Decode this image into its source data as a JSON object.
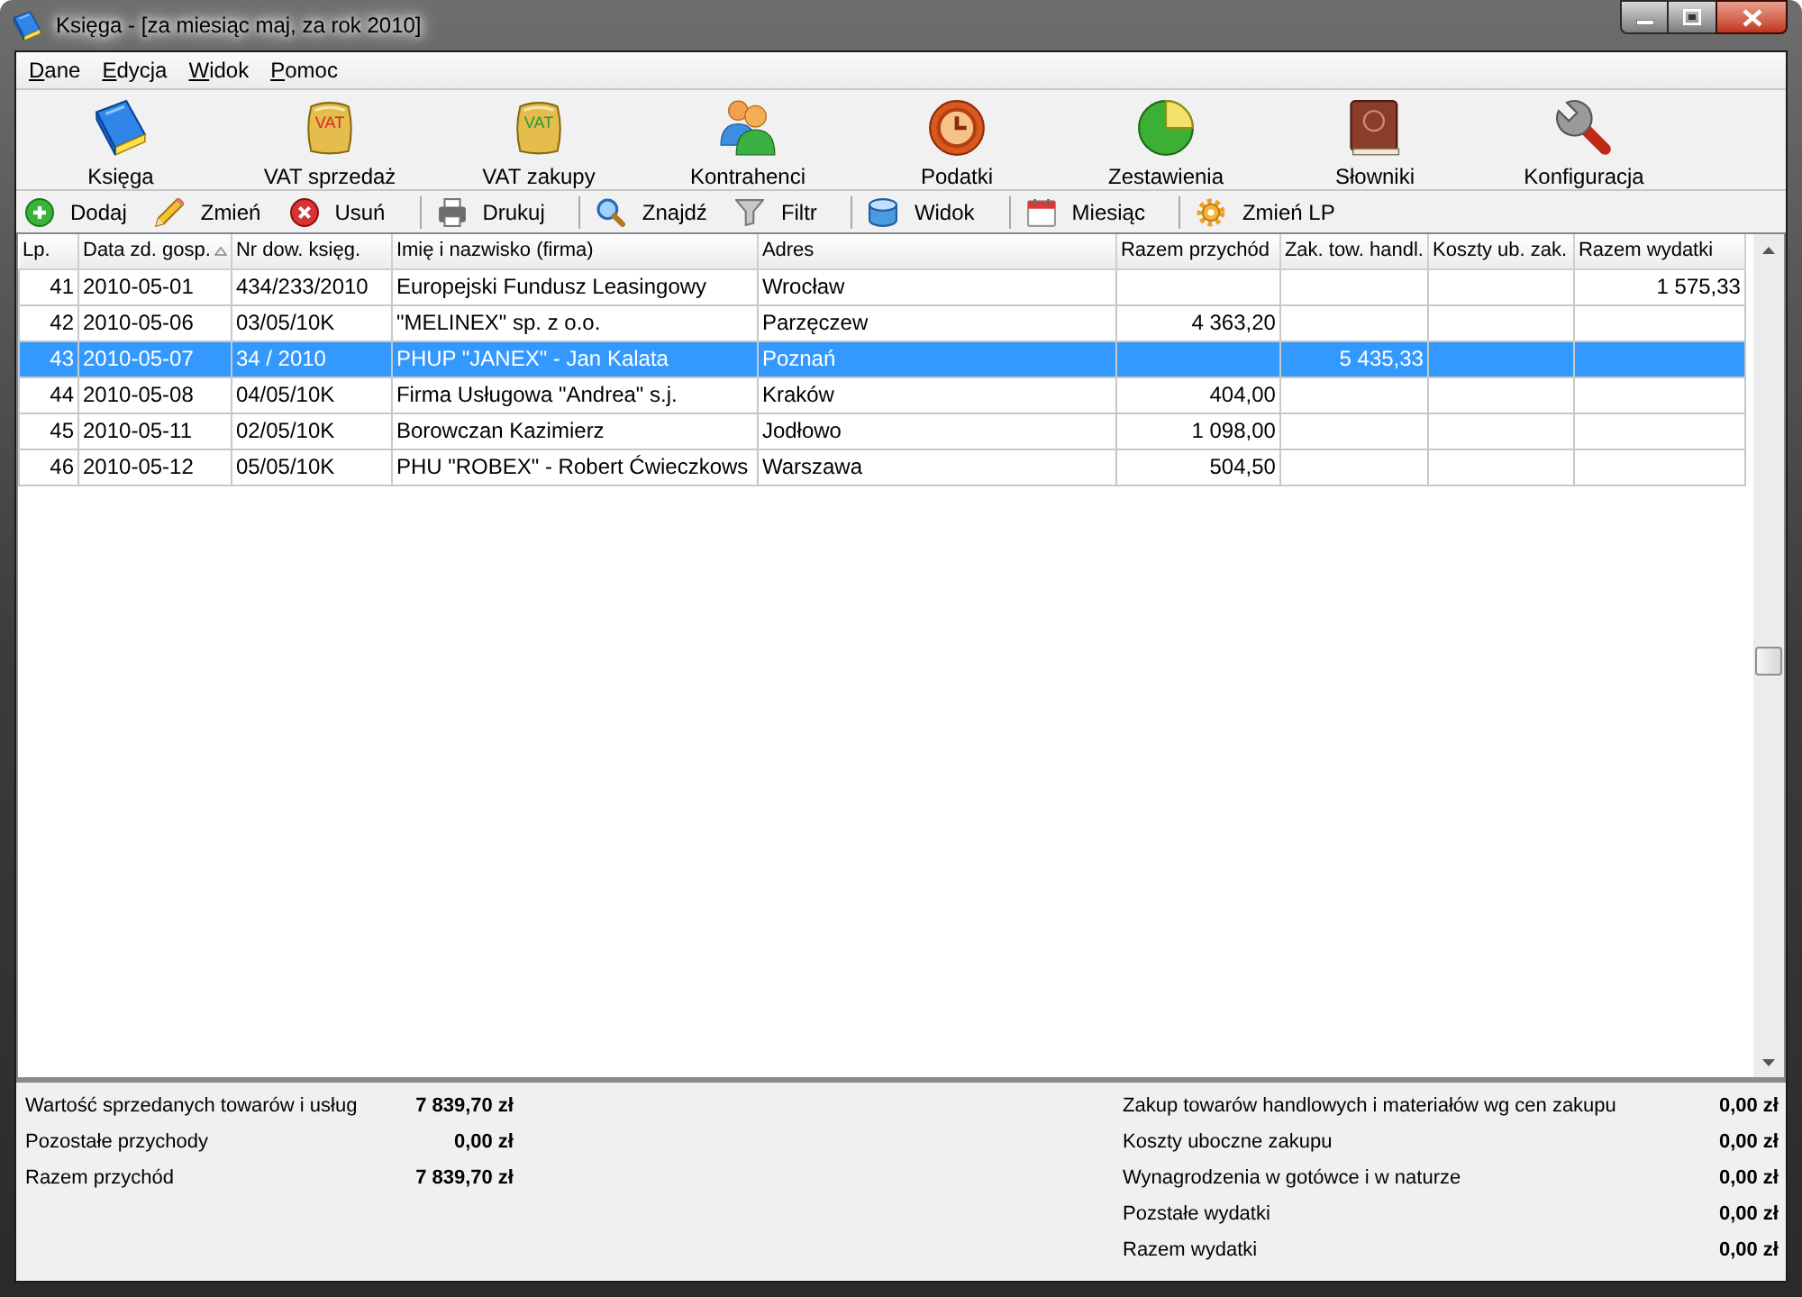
{
  "window": {
    "title": "Księga - [za miesiąc maj, za rok 2010]"
  },
  "menu": [
    "Dane",
    "Edycja",
    "Widok",
    "Pomoc"
  ],
  "modules": [
    {
      "label": "Księga"
    },
    {
      "label": "VAT sprzedaż",
      "badge": "VAT",
      "color": "#e02424"
    },
    {
      "label": "VAT zakupy",
      "badge": "VAT",
      "color": "#1f9e3a"
    },
    {
      "label": "Kontrahenci"
    },
    {
      "label": "Podatki"
    },
    {
      "label": "Zestawienia"
    },
    {
      "label": "Słowniki"
    },
    {
      "label": "Konfiguracja"
    }
  ],
  "toolbar": [
    [
      "Dodaj",
      "Zmień",
      "Usuń"
    ],
    [
      "Drukuj"
    ],
    [
      "Znajdź",
      "Filtr"
    ],
    [
      "Widok"
    ],
    [
      "Miesiąc"
    ],
    [
      "Zmień LP"
    ]
  ],
  "table": {
    "columns": [
      {
        "label": "Lp.",
        "sorted": false
      },
      {
        "label": "Data zd. gosp.",
        "sorted": true
      },
      {
        "label": "Nr dow. księg.",
        "sorted": false
      },
      {
        "label": "Imię i nazwisko (firma)",
        "sorted": false
      },
      {
        "label": "Adres",
        "sorted": false
      },
      {
        "label": "Razem przychód",
        "sorted": false
      },
      {
        "label": "Zak. tow. handl.",
        "sorted": false
      },
      {
        "label": "Koszty ub. zak.",
        "sorted": false
      },
      {
        "label": "Razem wydatki",
        "sorted": false
      }
    ],
    "rows": [
      {
        "selected": false,
        "lp": "41",
        "date": "2010-05-01",
        "document_no": "434/233/2010",
        "name": "Europejski Fundusz Leasingowy",
        "address": "Wrocław",
        "expenses_total": "1 575,33"
      },
      {
        "selected": false,
        "lp": "42",
        "date": "2010-05-06",
        "document_no": "03/05/10K",
        "name": "\"MELINEX\" sp. z o.o.",
        "address": "Parzęczew",
        "income_total": "4 363,20"
      },
      {
        "selected": true,
        "lp": "43",
        "date": "2010-05-07",
        "document_no": "34 / 2010",
        "name": "PHUP \"JANEX\" - Jan Kalata",
        "address": "Poznań",
        "goods_purchases": "5 435,33"
      },
      {
        "selected": false,
        "lp": "44",
        "date": "2010-05-08",
        "document_no": "04/05/10K",
        "name": "Firma Usługowa \"Andrea\" s.j.",
        "address": "Kraków",
        "income_total": "404,00"
      },
      {
        "selected": false,
        "lp": "45",
        "date": "2010-05-11",
        "document_no": "02/05/10K",
        "name": "Borowczan Kazimierz",
        "address": "Jodłowo",
        "income_total": "1 098,00"
      },
      {
        "selected": false,
        "lp": "46",
        "date": "2010-05-12",
        "document_no": "05/05/10K",
        "name": "PHU \"ROBEX\" - Robert Ćwieczkows",
        "address": "Warszawa",
        "income_total": "504,50"
      }
    ]
  },
  "summary": {
    "income": [
      {
        "label": "Wartość sprzedanych towarów i usług",
        "value": "7 839,70 zł"
      },
      {
        "label": "Pozostałe przychody",
        "value": "0,00 zł"
      },
      {
        "label": "Razem przychód",
        "value": "7 839,70 zł"
      }
    ],
    "expenses": [
      {
        "label": "Zakup towarów handlowych i materiałów wg cen zakupu",
        "value": "0,00 zł"
      },
      {
        "label": "Koszty uboczne zakupu",
        "value": "0,00 zł"
      },
      {
        "label": "Wynagrodzenia w gotówce i w naturze",
        "value": "0,00 zł"
      },
      {
        "label": "Pozstałe wydatki",
        "value": "0,00 zł"
      },
      {
        "label": "Razem wydatki",
        "value": "0,00 zł"
      }
    ]
  }
}
